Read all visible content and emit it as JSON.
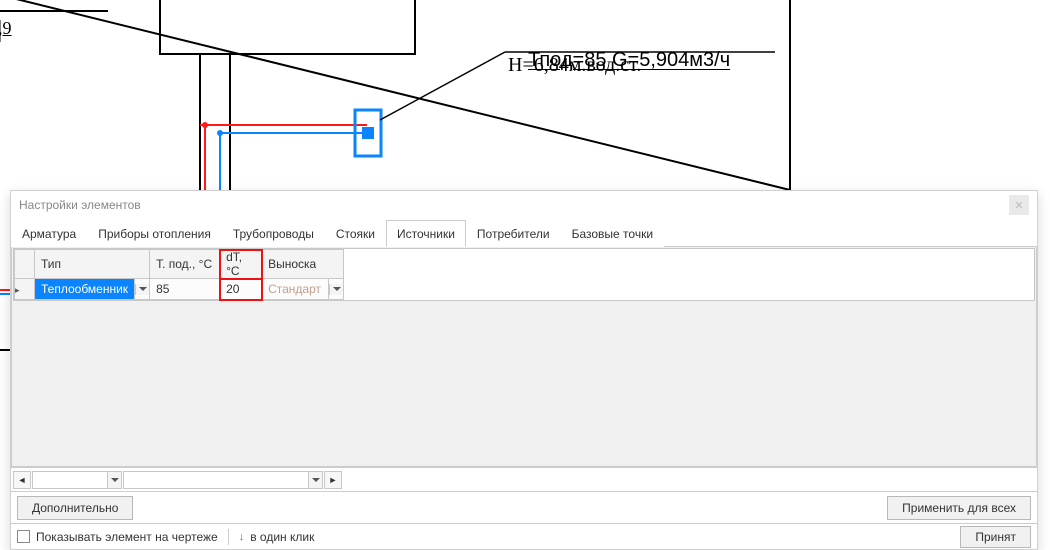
{
  "drawing": {
    "annotation_line1": "Тпод=85 G=5,904м3/ч",
    "annotation_line2": "Н=6,84м.вод.ст.",
    "dim_left": ",9"
  },
  "dialog": {
    "title": "Настройки элементов",
    "tabs": [
      "Арматура",
      "Приборы отопления",
      "Трубопроводы",
      "Стояки",
      "Источники",
      "Потребители",
      "Базовые точки"
    ],
    "active_tab_index": 4,
    "columns": {
      "type": "Тип",
      "t_pod": "Т. под., °С",
      "dt": "dT, °С",
      "leader": "Выноска"
    },
    "row": {
      "type_value": "Теплообменник",
      "t_pod_value": "85",
      "dt_value": "20",
      "leader_value": "Стандарт"
    },
    "buttons": {
      "additional": "Дополнительно",
      "apply_all": "Применить для всех",
      "accept": "Принят"
    },
    "footer": {
      "show_on_drawing": "Показывать элемент на чертеже",
      "one_click": "в один клик"
    }
  }
}
